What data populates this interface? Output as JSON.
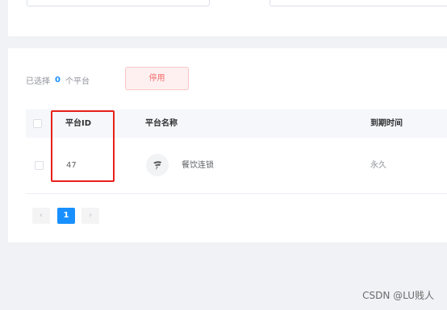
{
  "selection": {
    "prefix": "已选择",
    "count": "0",
    "suffix": "个平台"
  },
  "toolbar": {
    "disable_label": "停用"
  },
  "table": {
    "columns": [
      "平台ID",
      "平台名称",
      "到期时间"
    ],
    "rows": [
      {
        "id": "47",
        "name": "餐饮连锁",
        "expiry": "永久"
      }
    ]
  },
  "pagination": {
    "prev": "‹",
    "current": "1",
    "next": "›"
  },
  "watermark": "CSDN @LU贱人",
  "colors": {
    "primary": "#1890ff",
    "danger": "#f56c6c",
    "highlight": "#e8201a"
  }
}
